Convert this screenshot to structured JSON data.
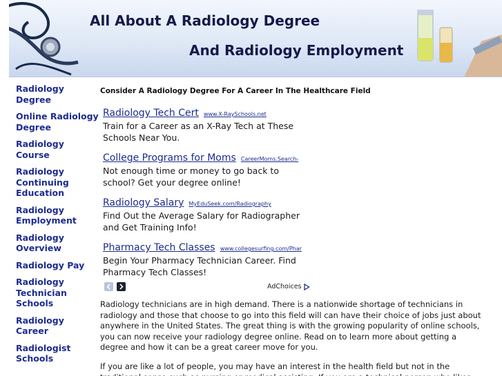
{
  "header": {
    "title_line1": "All About A Radiology Degree",
    "title_line2": "And Radiology Employment"
  },
  "sidebar": {
    "items": [
      {
        "label": "Radiology Degree"
      },
      {
        "label": "Online Radiology Degree"
      },
      {
        "label": "Radiology Course"
      },
      {
        "label": "Radiology Continuing Education"
      },
      {
        "label": "Radiology Employment"
      },
      {
        "label": "Radiology Overview"
      },
      {
        "label": "Radiology Pay"
      },
      {
        "label": "Radiology Technician Schools"
      },
      {
        "label": "Radiology Career"
      },
      {
        "label": "Radiologist Schools"
      }
    ]
  },
  "main": {
    "headline": "Consider A Radiology Degree For A Career In The Healthcare Field",
    "ads": [
      {
        "title": "Radiology Tech Cert",
        "url": "www.X-RaySchools.net",
        "desc": "Train for a Career as an X-Ray Tech at These Schools Near You."
      },
      {
        "title": "College Programs for Moms",
        "url": "CareerMoms.Search-",
        "desc": "Not enough time or money to go back to school? Get your degree online!"
      },
      {
        "title": "Radiology Salary",
        "url": "MyEduSeek.com/Radiography",
        "desc": "Find Out the Average Salary for Radiographer and Get Training Info!"
      },
      {
        "title": "Pharmacy Tech Classes",
        "url": "www.collegesurfing.com/Phar",
        "desc": "Begin Your Pharmacy Technician Career. Find Pharmacy Tech Classes!"
      }
    ],
    "adchoices_label": "AdChoices",
    "paragraph1": "Radiology technicians are in high demand. There is a nationwide shortage of technicians in radiology and those that choose to go into this field will can have their choice of jobs just about anywhere in the United States. The great thing is with the growing popularity of online schools, you can now receive your radiology degree online. Read on to learn more about getting a degree and how it can be a great career move for you.",
    "paragraph2": "If you are like a lot of people, you may have an interest in the health field but not in the traditional sense such as nursing or medical assisting. If you are a technical person who likes"
  },
  "icons": {
    "header_left": "stethoscope-image",
    "header_right": "medicine-vials-image",
    "ad_prev": "chevron-left-icon",
    "ad_next": "chevron-right-icon",
    "adchoices": "adchoices-triangle-icon"
  },
  "colors": {
    "link": "#1c2c8f",
    "header_title": "#151a4a",
    "header_bg": "#dfe8f6"
  }
}
